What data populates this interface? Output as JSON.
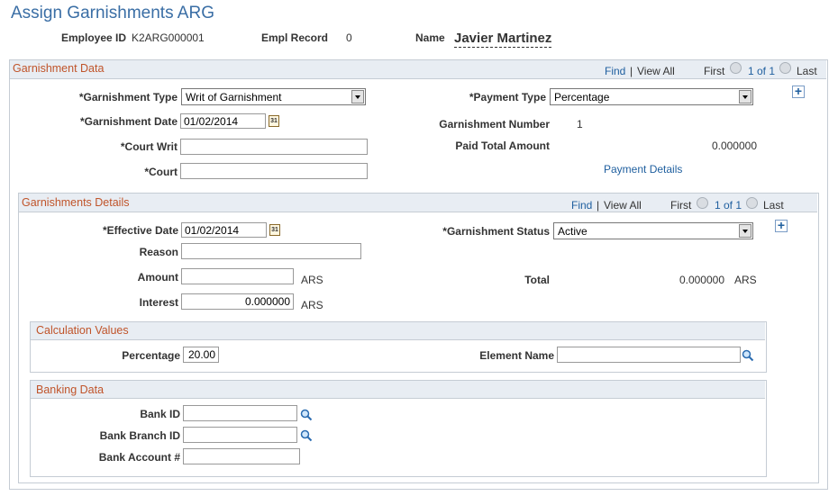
{
  "page": {
    "title": "Assign Garnishments ARG"
  },
  "employee": {
    "id_label": "Employee ID",
    "id_value": "K2ARG000001",
    "record_label": "Empl Record",
    "record_value": "0",
    "name_label": "Name",
    "name_value": "Javier Martinez"
  },
  "garnishment_data": {
    "header": "Garnishment Data",
    "nav": {
      "find": "Find",
      "separator": "|",
      "view_all": "View All",
      "first": "First",
      "count": "1 of 1",
      "last": "Last"
    },
    "type_label": "*Garnishment Type",
    "type_value": "Writ of Garnishment",
    "date_label": "*Garnishment Date",
    "date_value": "01/02/2014",
    "court_writ_label": "*Court Writ",
    "court_writ_value": "",
    "court_label": "*Court",
    "court_value": "",
    "payment_type_label": "*Payment Type",
    "payment_type_value": "Percentage",
    "number_label": "Garnishment Number",
    "number_value": "1",
    "paid_total_label": "Paid Total Amount",
    "paid_total_value": "0.000000",
    "payment_details_link": "Payment Details"
  },
  "garnishment_details": {
    "header": "Garnishments Details",
    "nav": {
      "find": "Find",
      "separator": "|",
      "view_all": "View All",
      "first": "First",
      "count": "1 of 1",
      "last": "Last"
    },
    "effective_date_label": "*Effective Date",
    "effective_date_value": "01/02/2014",
    "reason_label": "Reason",
    "reason_value": "",
    "amount_label": "Amount",
    "amount_value": "",
    "amount_currency": "ARS",
    "interest_label": "Interest",
    "interest_value": "0.000000",
    "interest_currency": "ARS",
    "status_label": "*Garnishment Status",
    "status_value": "Active",
    "total_label": "Total",
    "total_value": "0.000000",
    "total_currency": "ARS"
  },
  "calculation_values": {
    "header": "Calculation Values",
    "percentage_label": "Percentage",
    "percentage_value": "20.00",
    "element_name_label": "Element Name",
    "element_name_value": ""
  },
  "banking_data": {
    "header": "Banking Data",
    "bank_id_label": "Bank ID",
    "bank_id_value": "",
    "branch_id_label": "Bank Branch ID",
    "branch_id_value": "",
    "account_label": "Bank Account #",
    "account_value": ""
  },
  "icons": {
    "calendar": "calendar-icon",
    "lookup": "magnifier-icon",
    "add_row": "plus-icon",
    "prev": "previous-arrow-icon",
    "next": "next-arrow-icon",
    "calendar_glyph": "31",
    "add_glyph": "+"
  }
}
